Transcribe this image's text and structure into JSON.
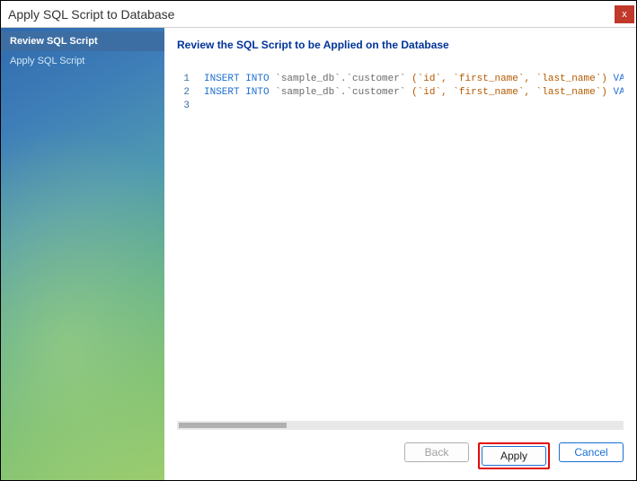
{
  "window": {
    "title": "Apply SQL Script to Database"
  },
  "sidebar": {
    "items": [
      {
        "label": "Review SQL Script",
        "active": true
      },
      {
        "label": "Apply SQL Script",
        "active": false
      }
    ]
  },
  "main": {
    "heading": "Review the SQL Script to be Applied on the Database",
    "sql_lines": [
      {
        "n": "1",
        "kw1": "INSERT INTO",
        "tbl": " `sample_db`.`customer` ",
        "cols": "(`id`, `first_name`, `last_name`) ",
        "kw2": "VALUES",
        "tail": " ("
      },
      {
        "n": "2",
        "kw1": "INSERT INTO",
        "tbl": " `sample_db`.`customer` ",
        "cols": "(`id`, `first_name`, `last_name`) ",
        "kw2": "VALUES",
        "tail": " ("
      },
      {
        "n": "3",
        "kw1": "",
        "tbl": "",
        "cols": "",
        "kw2": "",
        "tail": ""
      }
    ]
  },
  "buttons": {
    "back": "Back",
    "apply": "Apply",
    "cancel": "Cancel"
  },
  "close_glyph": "x"
}
